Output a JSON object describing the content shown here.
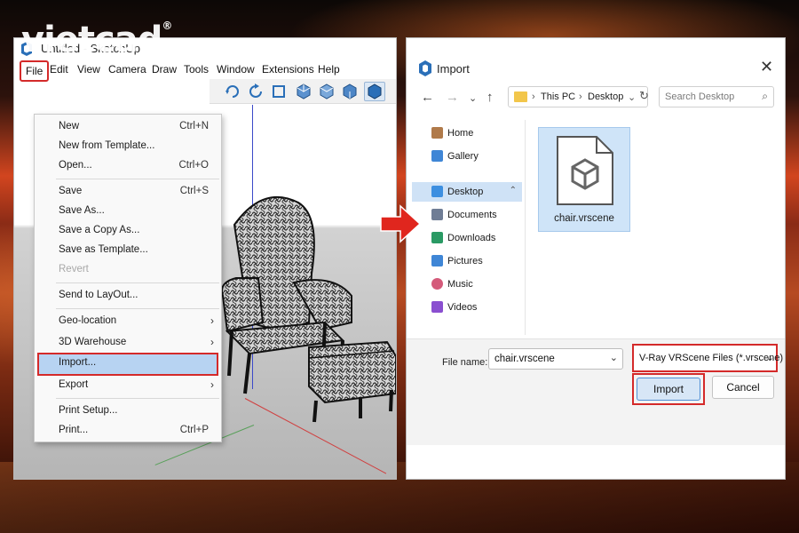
{
  "watermark": {
    "brand": "vietcad",
    "mark": "®"
  },
  "sketchup": {
    "title": "Untitled - SketchUp",
    "menubar": [
      "File",
      "Edit",
      "View",
      "Camera",
      "Draw",
      "Tools",
      "Window",
      "Extensions",
      "Help"
    ],
    "file_menu": {
      "new": {
        "label": "New",
        "shortcut": "Ctrl+N"
      },
      "new_template": {
        "label": "New from Template..."
      },
      "open": {
        "label": "Open...",
        "shortcut": "Ctrl+O"
      },
      "save": {
        "label": "Save",
        "shortcut": "Ctrl+S"
      },
      "save_as": {
        "label": "Save As..."
      },
      "save_copy": {
        "label": "Save a Copy As..."
      },
      "save_template": {
        "label": "Save as Template..."
      },
      "revert": {
        "label": "Revert"
      },
      "send_layout": {
        "label": "Send to LayOut..."
      },
      "geo_location": {
        "label": "Geo-location"
      },
      "warehouse": {
        "label": "3D Warehouse"
      },
      "import": {
        "label": "Import..."
      },
      "export": {
        "label": "Export"
      },
      "print_setup": {
        "label": "Print Setup..."
      },
      "print": {
        "label": "Print...",
        "shortcut": "Ctrl+P"
      }
    }
  },
  "import_dialog": {
    "title": "Import",
    "breadcrumb": [
      "This PC",
      "Desktop"
    ],
    "search_placeholder": "Search Desktop",
    "sidebar": [
      {
        "label": "Home",
        "icon": "home-icon",
        "color": "#b07a4a"
      },
      {
        "label": "Gallery",
        "icon": "gallery-icon",
        "color": "#3f86d6"
      },
      {
        "label": "Desktop",
        "icon": "desktop-icon",
        "color": "#3d8fe0",
        "selected": true
      },
      {
        "label": "Documents",
        "icon": "documents-icon",
        "color": "#6f7d95"
      },
      {
        "label": "Downloads",
        "icon": "downloads-icon",
        "color": "#2a9a64"
      },
      {
        "label": "Pictures",
        "icon": "pictures-icon",
        "color": "#3f86d6"
      },
      {
        "label": "Music",
        "icon": "music-icon",
        "color": "#d45a7a"
      },
      {
        "label": "Videos",
        "icon": "videos-icon",
        "color": "#8a4fd0"
      }
    ],
    "file": {
      "name": "chair.vrscene",
      "icon": "vrscene-file-icon"
    },
    "file_name_label": "File name:",
    "file_name_value": "chair.vrscene",
    "file_type": "V-Ray VRScene Files (*.vrscene)",
    "import_button": "Import",
    "cancel_button": "Cancel"
  },
  "colors": {
    "highlight_red": "#d42a2a",
    "selection_blue": "#b7d3f2",
    "arrow_red": "#e0261e"
  }
}
